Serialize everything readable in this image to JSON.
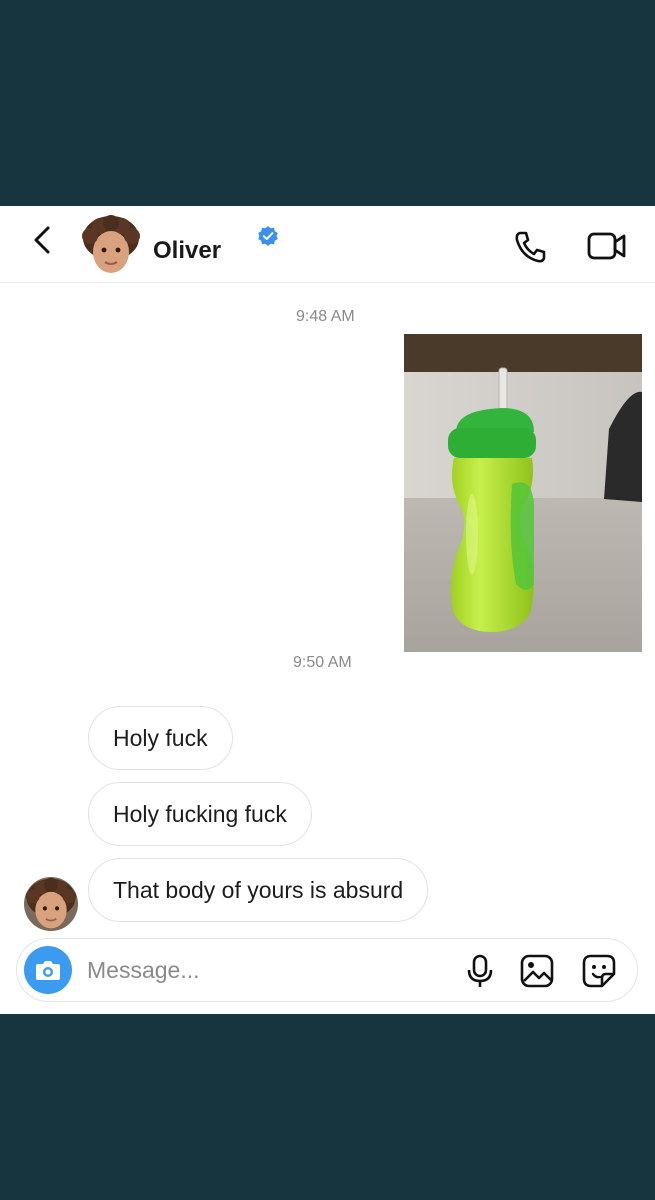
{
  "header": {
    "name": "Oliver",
    "verified": true,
    "icons": [
      "back-icon",
      "verified-badge-icon",
      "phone-icon",
      "video-camera-icon"
    ]
  },
  "messages": {
    "timestamp_1": "9:48 AM",
    "sent_photo": "green toddler sippy cup with straw",
    "timestamp_2": "9:50 AM",
    "received": [
      "Holy fuck",
      "Holy fucking fuck",
      "That body of yours is absurd"
    ]
  },
  "composer": {
    "placeholder": "Message...",
    "icons": [
      "camera-icon",
      "microphone-icon",
      "gallery-icon",
      "sticker-icon"
    ]
  },
  "colors": {
    "page_background": "#17353f",
    "accent_blue": "#3a9bf0",
    "bottle_green": "#b6e33a"
  }
}
